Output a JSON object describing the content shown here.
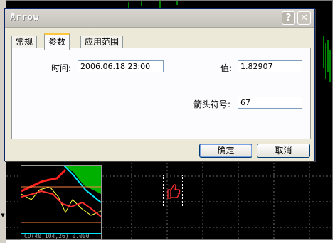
{
  "dialog": {
    "title": "Arrow",
    "help_glyph": "?",
    "close_glyph": "✕",
    "tabs": [
      {
        "label": "常规",
        "active": false
      },
      {
        "label": "参数",
        "active": true
      },
      {
        "label": "应用范围",
        "active": false
      }
    ],
    "fields": {
      "time_label": "时间:",
      "time_value": "2006.06.18 23:00",
      "price_label": "值:",
      "price_value": "1.82907",
      "arrow_code_label": "箭头符号:",
      "arrow_code_value": "67"
    },
    "buttons": {
      "ok_label": "确定",
      "cancel_label": "取消"
    }
  },
  "chart": {
    "background_color": "#000000",
    "grid_color": "#6a6a6a",
    "bar_color": "#00ff00",
    "arrow_icon": "thumbs-up-icon",
    "arrow_color": "#ff3333",
    "indicator_label": "CD(40,104,26) 0.000"
  },
  "scrollbar": {
    "down_glyph": "▼"
  }
}
